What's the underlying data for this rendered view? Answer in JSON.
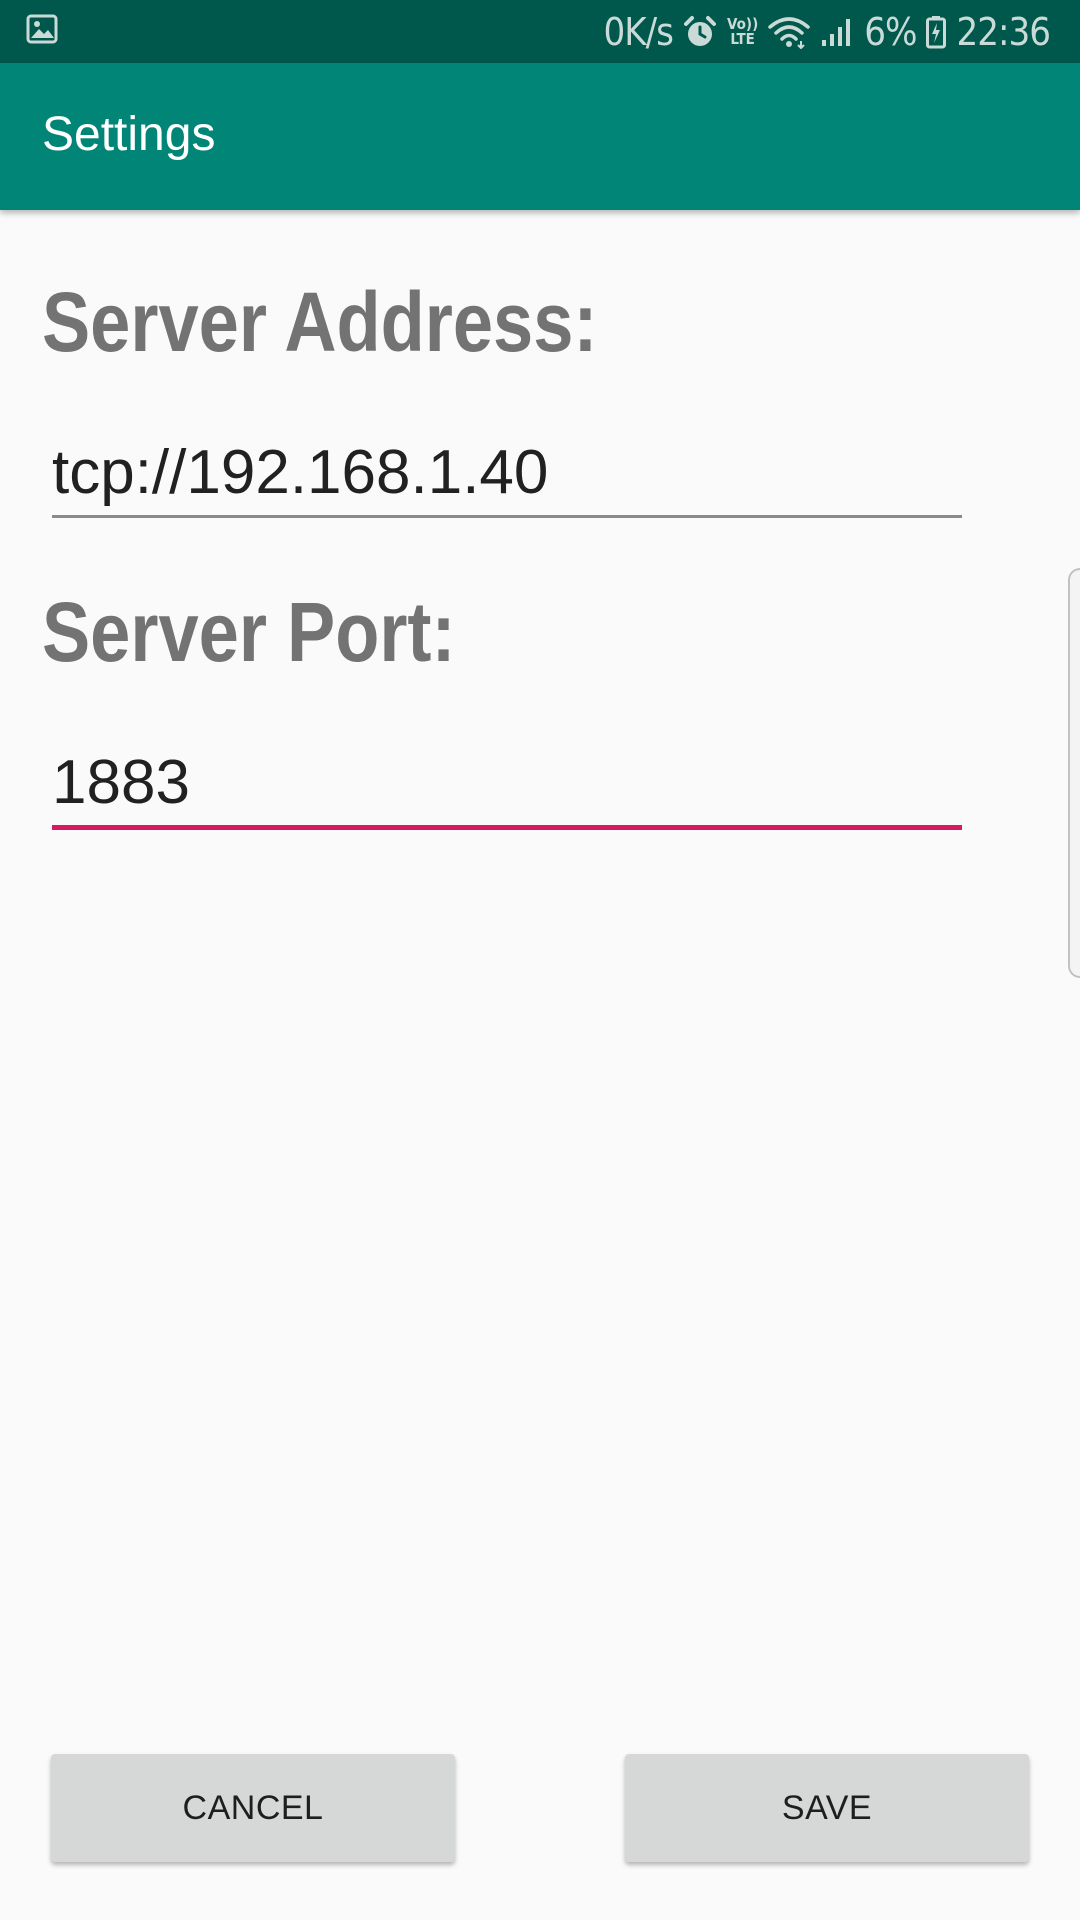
{
  "status_bar": {
    "left_icon": "image-icon",
    "net_speed": "0K/s",
    "alarm_icon": "alarm-icon",
    "volte_top": "Vo))",
    "volte_bottom": "LTE",
    "wifi_icon": "wifi-icon",
    "signal_icon": "signal-icon",
    "battery_percent": "6%",
    "battery_icon": "battery-charging-icon",
    "time": "22:36",
    "background_color": "#00574b"
  },
  "app_bar": {
    "title": "Settings",
    "background_color": "#008577"
  },
  "form": {
    "address_label": "Server Address:",
    "address_value": "tcp://192.168.1.40",
    "port_label": "Server Port:",
    "port_value": "1883",
    "focused_field": "port",
    "accent_color": "#d81b60"
  },
  "buttons": {
    "cancel_label": "CANCEL",
    "save_label": "SAVE"
  }
}
